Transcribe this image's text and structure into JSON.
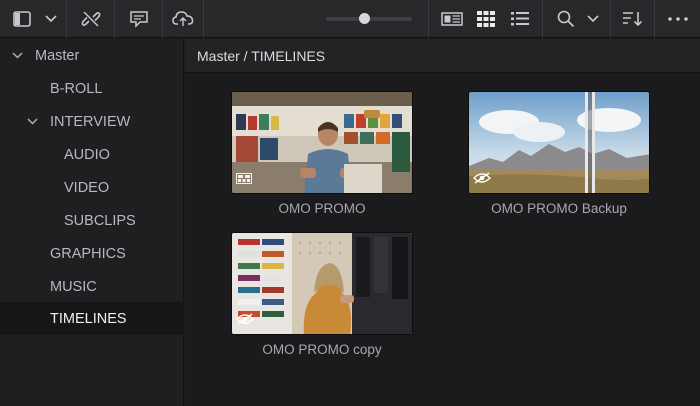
{
  "toolbar": {
    "icons": [
      "sidebar-panel-icon",
      "chevron-down-icon",
      "unlink-icon",
      "metadata-icon",
      "cloud-icon",
      "metadata-view-icon",
      "thumbnail-view-icon",
      "list-view-icon",
      "search-icon",
      "chevron-down-icon",
      "sort-icon",
      "more-icon"
    ],
    "zoom_level": 0.45
  },
  "sidebar": {
    "items": [
      {
        "label": "Master",
        "expandable": true,
        "expanded": true
      },
      {
        "label": "B-ROLL"
      },
      {
        "label": "INTERVIEW",
        "expandable": true,
        "expanded": true
      },
      {
        "label": "AUDIO"
      },
      {
        "label": "VIDEO"
      },
      {
        "label": "SUBCLIPS"
      },
      {
        "label": "GRAPHICS"
      },
      {
        "label": "MUSIC"
      },
      {
        "label": "TIMELINES",
        "selected": true
      }
    ]
  },
  "main": {
    "breadcrumb": "Master / TIMELINES",
    "clips": [
      {
        "label": "OMO PROMO",
        "badge": "timeline-icon"
      },
      {
        "label": "OMO PROMO Backup",
        "badge": "hidden-eye-icon"
      },
      {
        "label": "OMO PROMO copy",
        "badge": "hidden-eye-icon"
      }
    ]
  },
  "colors": {
    "background": "#1c1c1f",
    "toolbar": "#28282b",
    "selected_row": "#161618",
    "text": "#c8c8cc"
  }
}
